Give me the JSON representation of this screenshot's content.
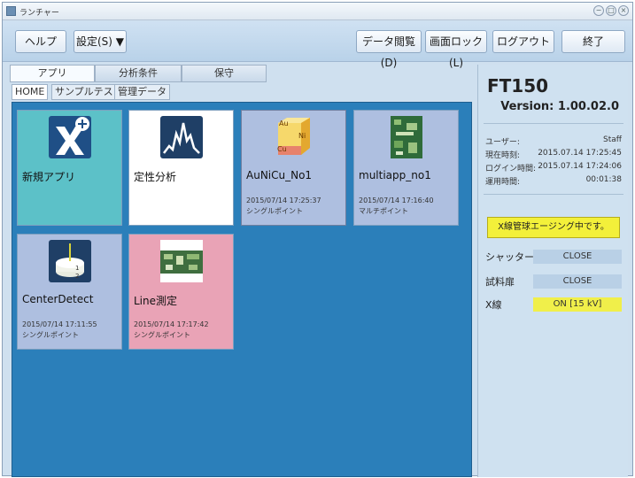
{
  "window": {
    "title": "ランチャー",
    "controls": [
      "−",
      "□",
      "×"
    ]
  },
  "toolbar": {
    "help": "ヘルプ",
    "settings": "設定(S) ▼",
    "data_view": "データ閲覧(D)",
    "screen_lock": "画面ロック(L)",
    "logout": "ログアウト",
    "exit": "終了"
  },
  "tabs": [
    "アプリ",
    "分析条件",
    "保守"
  ],
  "subtabs": [
    "HOME",
    "サンプルテスト",
    "管理データ"
  ],
  "tiles": [
    {
      "name": "新規アプリ",
      "date": "",
      "mode": ""
    },
    {
      "name": "定性分析",
      "date": "",
      "mode": ""
    },
    {
      "name": "AuNiCu_No1",
      "date": "2015/07/14 17:25:37",
      "mode": "シングルポイント",
      "icon_labels": [
        "Au",
        "Ni",
        "Cu"
      ]
    },
    {
      "name": "multiapp_no1",
      "date": "2015/07/14 17:16:40",
      "mode": "マルチポイント"
    },
    {
      "name": "CenterDetect",
      "date": "2015/07/14 17:11:55",
      "mode": "シングルポイント",
      "icon_labels": [
        "1",
        "2"
      ]
    },
    {
      "name": "Line測定",
      "date": "2015/07/14 17:17:42",
      "mode": "シングルポイント"
    }
  ],
  "panel": {
    "model": "FT150",
    "version": "Version: 1.00.02.0",
    "user_label": "ユーザー:",
    "user_value": "Staff",
    "time_label": "現在時刻:",
    "time_value": "2015.07.14 17:25:45",
    "login_label": "ログイン時間:",
    "login_value": "2015.07.14 17:24:06",
    "run_label": "運用時間:",
    "run_value": "00:01:38",
    "aging": "X線管球エージング中です。",
    "shutter_label": "シャッター",
    "shutter_value": "CLOSE",
    "door_label": "試料扉",
    "door_value": "CLOSE",
    "xray_label": "X線",
    "xray_value": "ON [15 kV]"
  },
  "colors": {
    "content_bg": "#2b7fba",
    "tile_teal": "#5cc1c8",
    "tile_white": "#ffffff",
    "tile_blue": "#aebfe0",
    "tile_pink": "#e9a3b6",
    "status_yellow": "#f3f03a"
  }
}
